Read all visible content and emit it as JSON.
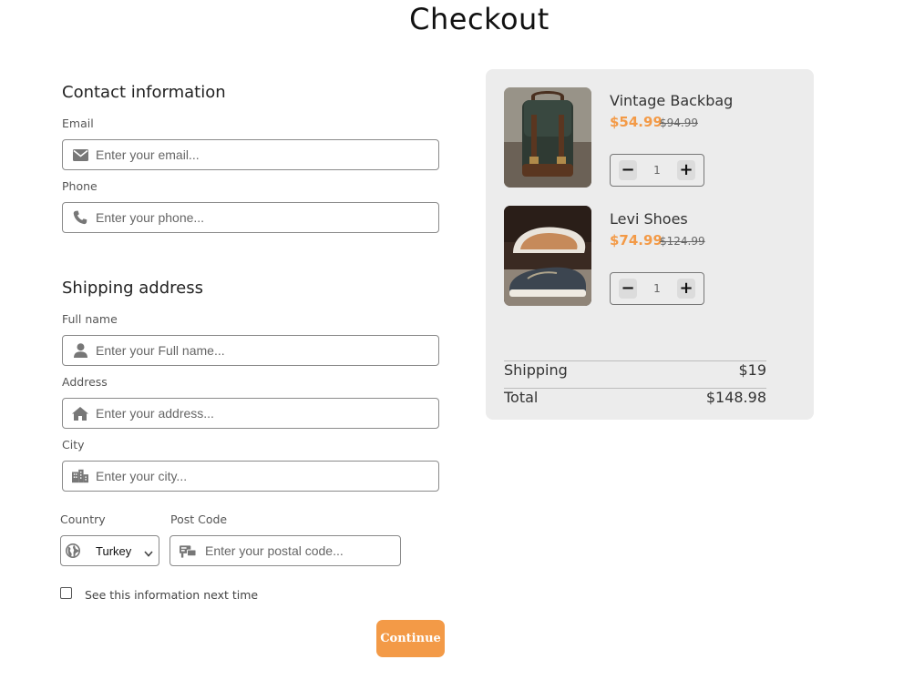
{
  "page": {
    "title": "Checkout"
  },
  "contact": {
    "title": "Contact information",
    "email_label": "Email",
    "email_placeholder": "Enter your email...",
    "phone_label": "Phone",
    "phone_placeholder": "Enter your phone..."
  },
  "shipping": {
    "title": "Shipping address",
    "fullname_label": "Full name",
    "fullname_placeholder": "Enter your Full name...",
    "address_label": "Address",
    "address_placeholder": "Enter your address...",
    "city_label": "City",
    "city_placeholder": "Enter your city...",
    "country_label": "Country",
    "country_value": "Turkey",
    "postcode_label": "Post Code",
    "postcode_placeholder": "Enter your postal code..."
  },
  "remember": {
    "label": "See this information next time",
    "checked": false
  },
  "actions": {
    "continue_label": "Continue"
  },
  "cart": {
    "items": [
      {
        "name": "Vintage Backbag",
        "price": "$54.99",
        "old_price": "$94.99",
        "quantity": "1"
      },
      {
        "name": "Levi Shoes",
        "price": "$74.99",
        "old_price": "$124.99",
        "quantity": "1"
      }
    ],
    "qty_minus": "−",
    "qty_plus": "+",
    "shipping_label": "Shipping",
    "shipping_value": "$19",
    "total_label": "Total",
    "total_value": "$148.98"
  },
  "colors": {
    "accent": "#f39a47",
    "panel": "#ececec",
    "icon": "#777777"
  }
}
